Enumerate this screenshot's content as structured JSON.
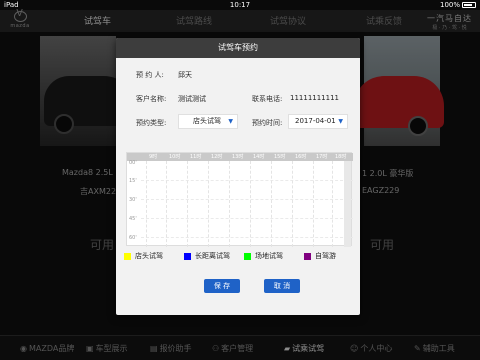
{
  "status_bar": {
    "device": "iPad",
    "time": "10:17",
    "battery": "100%"
  },
  "header": {
    "logo_text": "mazda",
    "tabs": [
      "试驾车",
      "试驾路线",
      "试驾协议",
      "试乘反馈"
    ],
    "active_tab": 0,
    "brand_main": "一汽马自达",
    "brand_sub": "极 · 乃 · 驾 · 悦"
  },
  "background": {
    "left_car_model": "Mazda8 2.5L",
    "left_car_plate": "吉AXM22",
    "left_status": "可用",
    "right_car_model": "1 2.0L 豪华版",
    "right_car_plate": "EAGZ229",
    "right_status": "可用"
  },
  "dialog": {
    "title": "试驾车预约",
    "reservation_person_label": "预 约 人:",
    "reservation_person_value": "邱天",
    "customer_name_label": "客户名称:",
    "customer_name_value": "测试测试",
    "phone_label": "联系电话:",
    "phone_value": "11111111111",
    "reservation_type_label": "预约类型:",
    "reservation_type_value": "店头试驾",
    "reservation_time_label": "预约时间:",
    "reservation_time_value": "2017-04-01",
    "hours": [
      "9时",
      "10时",
      "11时",
      "12时",
      "13时",
      "14时",
      "15时",
      "16时",
      "17时",
      "18时"
    ],
    "minutes": [
      "00'",
      "15'",
      "30'",
      "45'",
      "60'"
    ],
    "legend": [
      {
        "label": "店头试驾",
        "color": "#ffff00"
      },
      {
        "label": "长距离试驾",
        "color": "#0000ff"
      },
      {
        "label": "场地试驾",
        "color": "#00ff00"
      },
      {
        "label": "自驾游",
        "color": "#800080"
      }
    ],
    "save_label": "保 存",
    "cancel_label": "取 消"
  },
  "bottom_nav": {
    "items": [
      {
        "label": "MAZDA品牌",
        "icon": "MA"
      },
      {
        "label": "车型展示",
        "icon": "🚗"
      },
      {
        "label": "报价助手",
        "icon": "¥"
      },
      {
        "label": "客户管理",
        "icon": "👥"
      },
      {
        "label": "试乘试驾",
        "icon": "🚙"
      },
      {
        "label": "个人中心",
        "icon": "👤"
      },
      {
        "label": "辅助工具",
        "icon": "🔧"
      }
    ],
    "active_index": 4
  }
}
